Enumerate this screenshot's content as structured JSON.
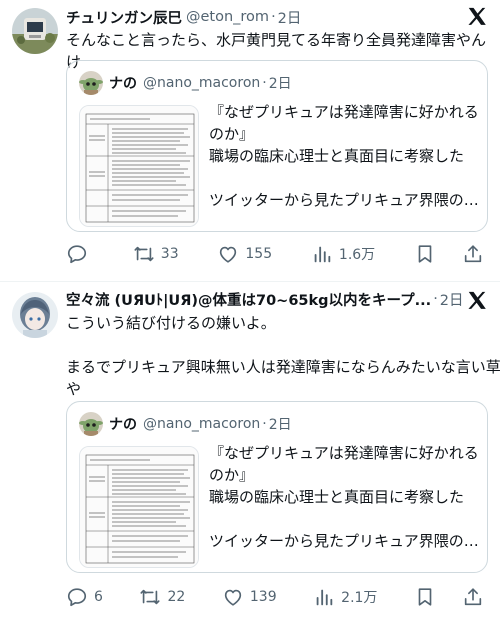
{
  "tweets": [
    {
      "name": "チュリンガン辰巳",
      "handle": "@eton_rom",
      "time": "2日",
      "text": "そんなこと言ったら、水戸黄門見てる年寄り全員発達障害やんけ",
      "quote": {
        "name": "ナの",
        "handle": "@nano_macoron",
        "time": "2日",
        "lines": [
          "『なぜプリキュアは発達障害に好かれる",
          "のか』",
          "職場の臨床心理士と真面目に考察した",
          "ツイッターから見たプリキュア界隈の大..."
        ]
      },
      "actions": {
        "replies": "",
        "retweets": "33",
        "likes": "155",
        "views": "1.6万"
      }
    },
    {
      "name": "空々流 (UЯUﾄ|UЯ)@体重は70~65kg以内をキープ...",
      "handle": "",
      "time": "2日",
      "text_lines": [
        "こういう結び付けるの嫌いよ。",
        "まるでプリキュア興味無い人は発達障害にならんみたいな言い草",
        "や"
      ],
      "quote": {
        "name": "ナの",
        "handle": "@nano_macoron",
        "time": "2日",
        "lines": [
          "『なぜプリキュアは発達障害に好かれる",
          "のか』",
          "職場の臨床心理士と真面目に考察した",
          "ツイッターから見たプリキュア界隈の大..."
        ]
      },
      "actions": {
        "replies": "6",
        "retweets": "22",
        "likes": "139",
        "views": "2.1万"
      }
    }
  ],
  "icons": [
    "x-logo-icon",
    "reply-icon",
    "retweet-icon",
    "like-icon",
    "views-icon",
    "bookmark-icon",
    "share-icon"
  ],
  "colors": {
    "muted": "#536471",
    "text": "#0f1419",
    "border": "#cfd9de"
  }
}
